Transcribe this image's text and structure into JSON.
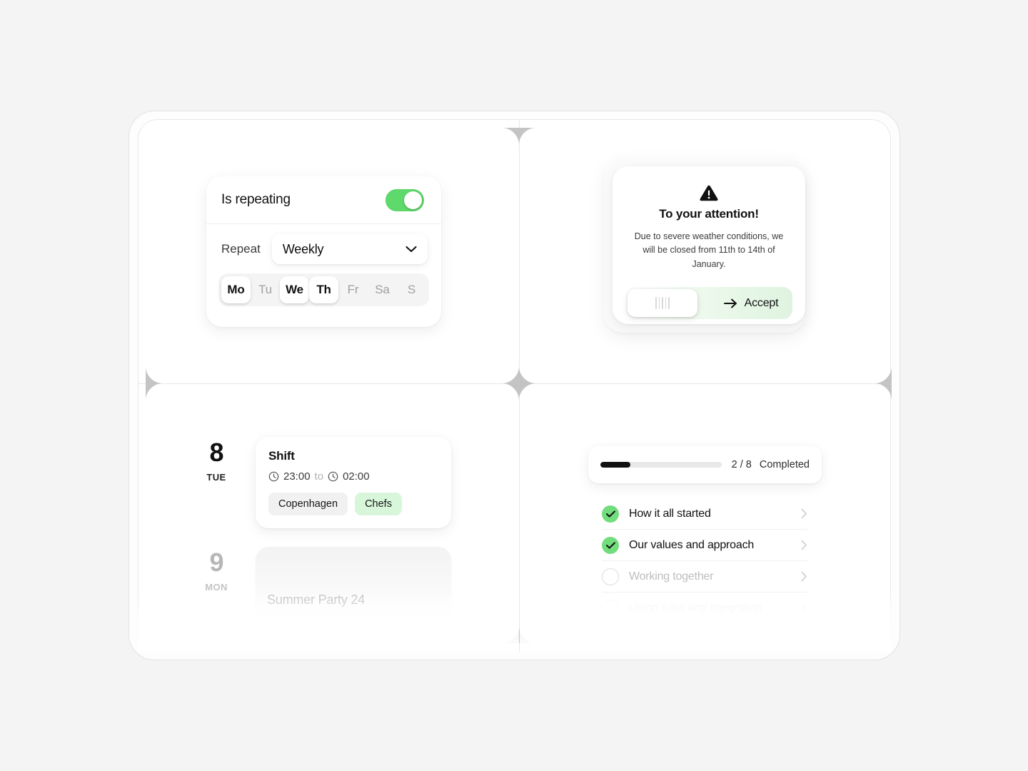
{
  "theme": {
    "background": "#f4f4f4",
    "accent_green": "#5ed96b",
    "chip_green": "#d8f6da",
    "text_primary": "#111111",
    "text_muted": "#b3b3b3"
  },
  "repeat_card": {
    "title": "Is repeating",
    "toggle_on": true,
    "repeat_label": "Repeat",
    "frequency_value": "Weekly",
    "frequency_options": [
      "Weekly"
    ],
    "days": [
      {
        "label": "Mo",
        "selected": true
      },
      {
        "label": "Tu",
        "selected": false
      },
      {
        "label": "We",
        "selected": true
      },
      {
        "label": "Th",
        "selected": true
      },
      {
        "label": "Fr",
        "selected": false
      },
      {
        "label": "Sa",
        "selected": false
      },
      {
        "label": "S",
        "selected": false
      }
    ]
  },
  "alert": {
    "icon": "warning-triangle-icon",
    "title": "To your attention!",
    "body": "Due to severe weather conditions, we will be closed from 11th to 14th of January.",
    "accept_label": "Accept"
  },
  "schedule": {
    "entries": [
      {
        "day_number": "8",
        "day_name": "TUE",
        "title": "Shift",
        "time_start": "23:00",
        "time_separator": "to",
        "time_end": "02:00",
        "tags": [
          {
            "label": "Copenhagen",
            "style": "gray"
          },
          {
            "label": "Chefs",
            "style": "green"
          }
        ]
      },
      {
        "day_number": "9",
        "day_name": "MON",
        "title": "Summer Party 24"
      }
    ]
  },
  "onboarding": {
    "progress_completed": 2,
    "progress_total": 8,
    "progress_fraction": "2 / 8",
    "progress_label": "Completed",
    "progress_percent": 25,
    "tasks": [
      {
        "label": "How it all started",
        "state": "done"
      },
      {
        "label": "Our values and approach",
        "state": "done"
      },
      {
        "label": "Working together",
        "state": "pending"
      },
      {
        "label": "Union rules and integration",
        "state": "pending"
      }
    ]
  }
}
